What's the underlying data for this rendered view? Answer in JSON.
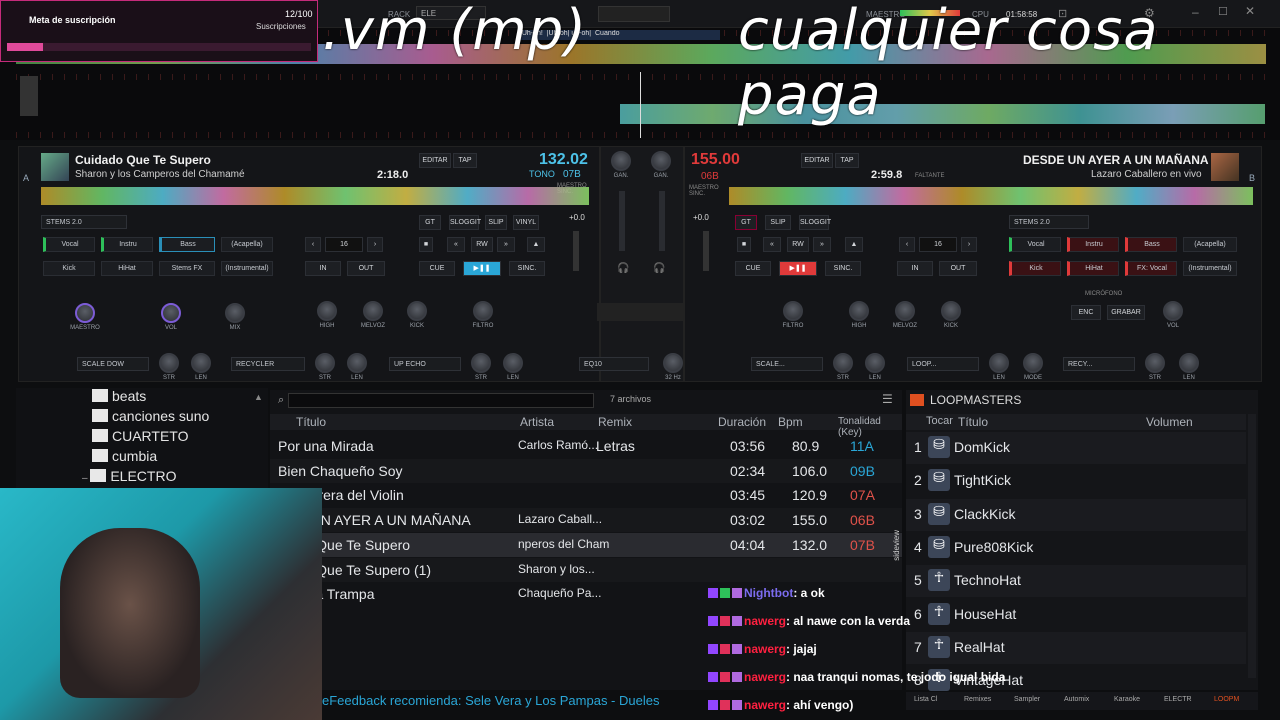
{
  "overlay": {
    "sub_title": "Meta de suscripción",
    "sub_count": "12/100",
    "sub_label": "Suscripciones",
    "sub_progress": 0.12,
    "big_left": ".vm (mp)",
    "big_right": "cualquier cosa paga"
  },
  "topbar": {
    "rack_label": "RACK",
    "rack_value": "ELE",
    "master_label": "MAESTRO",
    "cpu_label": "CPU",
    "clock": "01:58:58"
  },
  "overview": {
    "lyrics": [
      "|Uh-oh!",
      "|Uh-oh| uh-oh|",
      "Cuando"
    ]
  },
  "deckA": {
    "letter": "A",
    "title": "Cuidado Que Te Supero",
    "artist": "Sharon y los Camperos del Chamamé",
    "bpm": "132.02",
    "key": "07B",
    "time": "2:18.0",
    "edit": "EDITAR",
    "tap": "TAP",
    "tone": "TONO",
    "master_sync": "MAESTRO SINC.",
    "stems_preset": "STEMS 2.0",
    "stems": [
      "Vocal",
      "Instru",
      "Bass",
      "(Acapella)",
      "Kick",
      "HiHat",
      "Stems FX",
      "(Instrumental)"
    ],
    "loop_size": "16",
    "in": "IN",
    "out": "OUT",
    "cue": "CUE",
    "sync": "SINC.",
    "small_btns": [
      "GT",
      "SLOGGIT",
      "SLIP",
      "VINYL"
    ],
    "pitch": "+0.0",
    "knobs": [
      "MAESTRO",
      "VOL",
      "MIX"
    ],
    "eq": [
      "HIGH",
      "MELVOZ",
      "KICK",
      "FILTRO"
    ],
    "fx": [
      {
        "name": "SCALE DOW",
        "k": [
          "STR",
          "LEN"
        ]
      },
      {
        "name": "RECYCLER",
        "k": [
          "STR",
          "LEN"
        ]
      },
      {
        "name": "UP ECHO",
        "k": [
          "STR",
          "LEN"
        ]
      }
    ]
  },
  "deckB": {
    "letter": "B",
    "title": "DESDE UN AYER A UN MAÑANA",
    "artist": "Lazaro Caballero en vivo",
    "bpm": "155.00",
    "key": "06B",
    "time": "2:59.8",
    "remaining": "FALTANTE",
    "edit": "EDITAR",
    "tap": "TAP",
    "master_sync": "MAESTRO SINC.",
    "stems_preset": "STEMS 2.0",
    "stems": [
      "Vocal",
      "Instru",
      "Bass",
      "(Acapella)",
      "Kick",
      "HiHat",
      "FX: Vocal",
      "(Instrumental)"
    ],
    "loop_size": "16",
    "in": "IN",
    "out": "OUT",
    "cue": "CUE",
    "sync": "SINC.",
    "pitch": "+0.0",
    "eq": [
      "FILTRO",
      "HIGH",
      "MELVOZ",
      "KICK"
    ],
    "mic_label": "MICRÓFONO",
    "mic_btns": [
      "ENC",
      "GRABAR"
    ],
    "mic_vol": "VOL",
    "fx": [
      {
        "name": "SCALE...",
        "k": [
          "STR",
          "LEN"
        ]
      },
      {
        "name": "LOOP...",
        "k": [
          "LEN",
          "MODE"
        ]
      },
      {
        "name": "RECY...",
        "k": [
          "STR",
          "LEN"
        ]
      }
    ]
  },
  "mixer": {
    "gain": "GAN.",
    "eq_name": "EQ10",
    "eq_k": [
      "32 Hz",
      "63 Hz"
    ],
    "master": "MAESTRO"
  },
  "browser": {
    "folders": [
      "beats",
      "canciones suno",
      "CUARTETO",
      "cumbia",
      "ELECTRO"
    ],
    "search_placeholder": "",
    "count": "7 archivos",
    "headers": [
      "Título",
      "Artista",
      "Remix",
      "Duración",
      "Bpm",
      "Tonalidad (Key)"
    ],
    "rows": [
      {
        "title": "Por una Mirada",
        "artist": "Carlos Ramó...",
        "remix": "Letras",
        "dur": "03:56",
        "bpm": "80.9",
        "key": "11A"
      },
      {
        "title": "Bien Chaqueño Soy",
        "artist": "",
        "remix": "",
        "dur": "02:34",
        "bpm": "106.0",
        "key": "09B"
      },
      {
        "title": "Chacarera del Violin",
        "artist": "",
        "remix": "",
        "dur": "03:45",
        "bpm": "120.9",
        "key": "07A"
      },
      {
        "title": "SDE UN AYER A UN MAÑANA",
        "artist": "Lazaro Caball...",
        "remix": "",
        "dur": "03:02",
        "bpm": "155.0",
        "key": "06B"
      },
      {
        "title": "idado Que Te Supero",
        "artist": "nperos del Cham",
        "remix": "",
        "dur": "04:04",
        "bpm": "132.0",
        "key": "07B"
      },
      {
        "title": "idado Que Te Supero (1)",
        "artist": "Sharon y los...",
        "remix": "",
        "dur": "",
        "bpm": "",
        "key": ""
      },
      {
        "title": "ey y La Trampa",
        "artist": "Chaqueño Pa...",
        "remix": "",
        "dur": "",
        "bpm": "",
        "key": ""
      }
    ],
    "sideview": "sideview"
  },
  "loops": {
    "title": "LOOPMASTERS",
    "headers": [
      "Tocar",
      "Título",
      "Volumen"
    ],
    "items": [
      "DomKick",
      "TightKick",
      "ClackKick",
      "Pure808Kick",
      "TechnoHat",
      "HouseHat",
      "RealHat",
      "VintageHat"
    ]
  },
  "chat": [
    {
      "user": "Nightbot",
      "msg": ": a ok"
    },
    {
      "user": "nawerg",
      "msg": ": al nawe con la verda"
    },
    {
      "user": "nawerg",
      "msg": ": jajaj"
    },
    {
      "user": "nawerg",
      "msg": ": naa tranqui nomas, te jodo igual bida"
    },
    {
      "user": "nawerg",
      "msg": ": ahí vengo)"
    }
  ],
  "ticker": "eFeedback recomienda: Sele Vera y Los Pampas - Dueles",
  "bottom_tabs": [
    "Lista Cl",
    "Remixes",
    "Sampler",
    "Automix",
    "Karaoke",
    "ELECTR",
    "LOOPM"
  ],
  "colors": {
    "accent_green": "#2ec05a",
    "accent_red": "#e03a3a",
    "accent_blue": "#2aa6d6",
    "pink": "#c42b7a",
    "key_red": "#e0524a"
  }
}
